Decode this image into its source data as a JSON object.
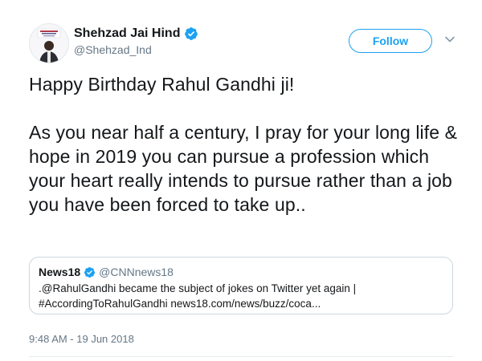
{
  "author": {
    "display_name": "Shehzad Jai Hind",
    "handle": "@Shehzad_Ind",
    "verified": true
  },
  "follow_button": {
    "label": "Follow"
  },
  "tweet": {
    "paragraphs": [
      "Happy Birthday Rahul Gandhi ji!",
      "As you near half a century, I pray for your long life & hope in 2019 you can pursue a profession which your heart really intends to pursue rather than a job you have been forced to take up.."
    ]
  },
  "quoted_tweet": {
    "name": "News18",
    "handle": "@CNNnews18",
    "verified": true,
    "text_line1": ".@RahulGandhi became the subject of jokes on Twitter yet again |",
    "text_line2": "#AccordingToRahulGandhi news18.com/news/buzz/coca..."
  },
  "timestamp": "9:48 AM - 19 Jun 2018",
  "colors": {
    "accent": "#1da1f2",
    "secondary_text": "#657786",
    "border": "#ccd6dd"
  }
}
